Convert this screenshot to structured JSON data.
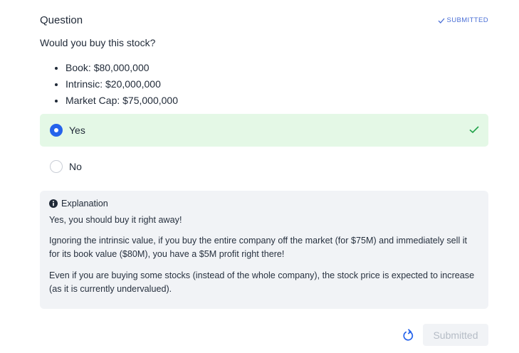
{
  "question": {
    "title": "Question",
    "status": "SUBMITTED",
    "prompt": "Would you buy this stock?",
    "facts": [
      "Book: $80,000,000",
      "Intrinsic: $20,000,000",
      "Market Cap: $75,000,000"
    ]
  },
  "options": [
    {
      "label": "Yes",
      "selected": true,
      "correct": true
    },
    {
      "label": "No",
      "selected": false
    }
  ],
  "explanation": {
    "heading": "Explanation",
    "paragraphs": [
      "Yes, you should buy it right away!",
      "Ignoring the intrinsic value, if you buy the entire company off the market (for $75M) and immediately sell it for its book value ($80M), you have a $5M profit right there!",
      "Even if you are buying some stocks (instead of the whole company), the stock price is expected to increase (as it is currently undervalued)."
    ]
  },
  "actions": {
    "submit_label": "Submitted",
    "reset_icon": "reset-icon"
  },
  "colors": {
    "accent": "#2563eb",
    "status": "#4a6fd6",
    "correct_bg": "#e4f8e6",
    "correct_check": "#22a24a",
    "panel_bg": "#f1f3f6"
  }
}
